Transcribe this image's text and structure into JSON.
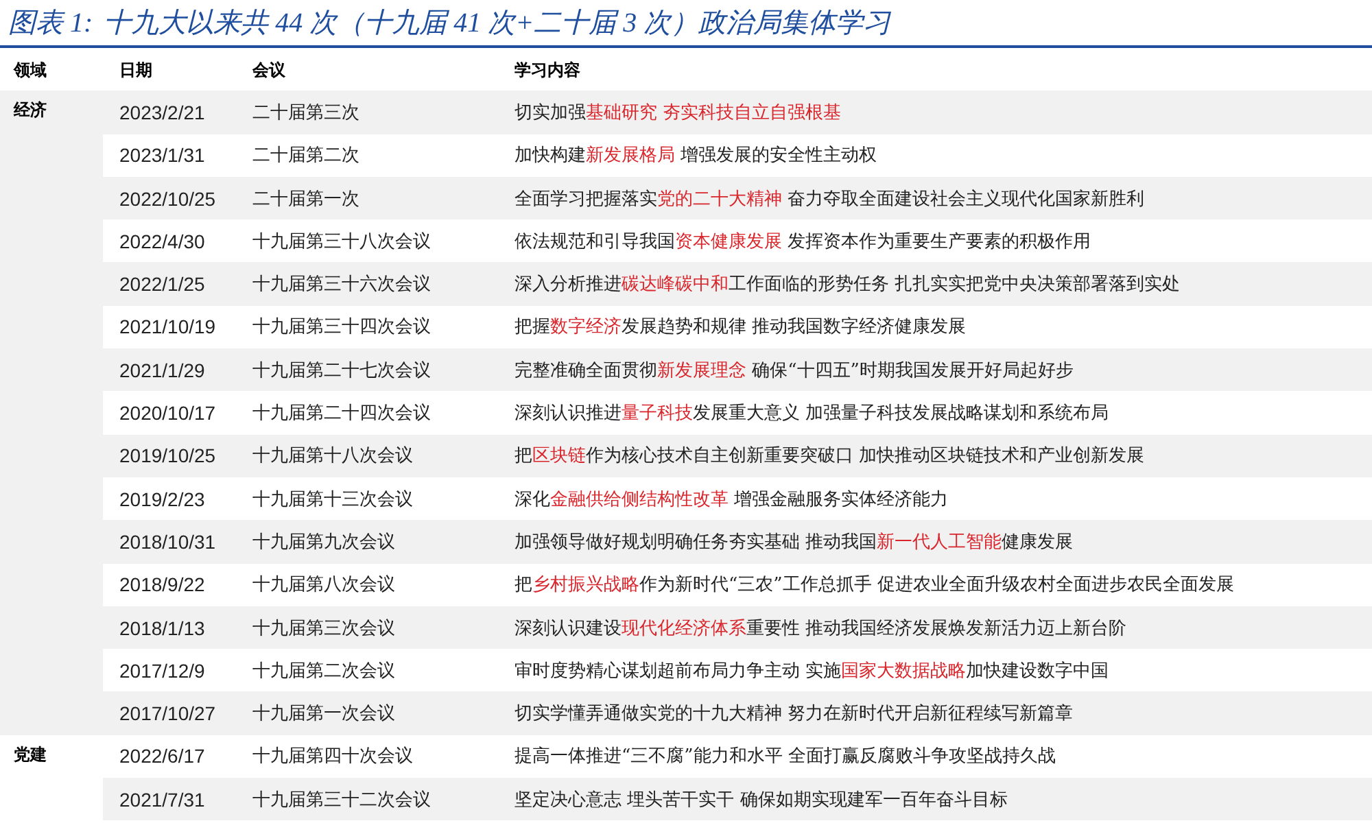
{
  "title": {
    "label": "图表 1:",
    "text": "十九大以来共 44 次（十九届 41 次+二十届 3 次）政治局集体学习"
  },
  "table": {
    "columns": [
      "领域",
      "日期",
      "会议",
      "学习内容"
    ],
    "groups": [
      {
        "domain": "经济",
        "rows": [
          {
            "date": "2023/2/21",
            "meeting": "二十届第三次",
            "content": [
              {
                "text": "切实加强",
                "highlight": false
              },
              {
                "text": "基础研究 夯实科技自立自强根基",
                "highlight": true
              }
            ]
          },
          {
            "date": "2023/1/31",
            "meeting": "二十届第二次",
            "content": [
              {
                "text": "加快构建",
                "highlight": false
              },
              {
                "text": "新发展格局",
                "highlight": true
              },
              {
                "text": " 增强发展的安全性主动权",
                "highlight": false
              }
            ]
          },
          {
            "date": "2022/10/25",
            "meeting": "二十届第一次",
            "content": [
              {
                "text": "全面学习把握落实",
                "highlight": false
              },
              {
                "text": "党的二十大精神",
                "highlight": true
              },
              {
                "text": " 奋力夺取全面建设社会主义现代化国家新胜利",
                "highlight": false
              }
            ]
          },
          {
            "date": "2022/4/30",
            "meeting": "十九届第三十八次会议",
            "content": [
              {
                "text": "依法规范和引导我国",
                "highlight": false
              },
              {
                "text": "资本健康发展",
                "highlight": true
              },
              {
                "text": " 发挥资本作为重要生产要素的积极作用",
                "highlight": false
              }
            ]
          },
          {
            "date": "2022/1/25",
            "meeting": "十九届第三十六次会议",
            "content": [
              {
                "text": "深入分析推进",
                "highlight": false
              },
              {
                "text": "碳达峰碳中和",
                "highlight": true
              },
              {
                "text": "工作面临的形势任务 扎扎实实把党中央决策部署落到实处",
                "highlight": false
              }
            ]
          },
          {
            "date": "2021/10/19",
            "meeting": "十九届第三十四次会议",
            "content": [
              {
                "text": "把握",
                "highlight": false
              },
              {
                "text": "数字经济",
                "highlight": true
              },
              {
                "text": "发展趋势和规律 推动我国数字经济健康发展",
                "highlight": false
              }
            ]
          },
          {
            "date": "2021/1/29",
            "meeting": "十九届第二十七次会议",
            "content": [
              {
                "text": "完整准确全面贯彻",
                "highlight": false
              },
              {
                "text": "新发展理念",
                "highlight": true
              },
              {
                "text": " 确保“十四五”时期我国发展开好局起好步",
                "highlight": false
              }
            ]
          },
          {
            "date": "2020/10/17",
            "meeting": "十九届第二十四次会议",
            "content": [
              {
                "text": "深刻认识推进",
                "highlight": false
              },
              {
                "text": "量子科技",
                "highlight": true
              },
              {
                "text": "发展重大意义 加强量子科技发展战略谋划和系统布局",
                "highlight": false
              }
            ]
          },
          {
            "date": "2019/10/25",
            "meeting": "十九届第十八次会议",
            "content": [
              {
                "text": "把",
                "highlight": false
              },
              {
                "text": "区块链",
                "highlight": true
              },
              {
                "text": "作为核心技术自主创新重要突破口 加快推动区块链技术和产业创新发展",
                "highlight": false
              }
            ]
          },
          {
            "date": "2019/2/23",
            "meeting": "十九届第十三次会议",
            "content": [
              {
                "text": "深化",
                "highlight": false
              },
              {
                "text": "金融供给侧结构性改革",
                "highlight": true
              },
              {
                "text": " 增强金融服务实体经济能力",
                "highlight": false
              }
            ]
          },
          {
            "date": "2018/10/31",
            "meeting": "十九届第九次会议",
            "content": [
              {
                "text": "加强领导做好规划明确任务夯实基础 推动我国",
                "highlight": false
              },
              {
                "text": "新一代人工智能",
                "highlight": true
              },
              {
                "text": "健康发展",
                "highlight": false
              }
            ]
          },
          {
            "date": "2018/9/22",
            "meeting": "十九届第八次会议",
            "content": [
              {
                "text": "把",
                "highlight": false
              },
              {
                "text": "乡村振兴战略",
                "highlight": true
              },
              {
                "text": "作为新时代“三农”工作总抓手 促进农业全面升级农村全面进步农民全面发展",
                "highlight": false
              }
            ]
          },
          {
            "date": "2018/1/13",
            "meeting": "十九届第三次会议",
            "content": [
              {
                "text": "深刻认识建设",
                "highlight": false
              },
              {
                "text": "现代化经济体系",
                "highlight": true
              },
              {
                "text": "重要性 推动我国经济发展焕发新活力迈上新台阶",
                "highlight": false
              }
            ]
          },
          {
            "date": "2017/12/9",
            "meeting": "十九届第二次会议",
            "content": [
              {
                "text": "审时度势精心谋划超前布局力争主动 实施",
                "highlight": false
              },
              {
                "text": "国家大数据战略",
                "highlight": true
              },
              {
                "text": "加快建设数字中国",
                "highlight": false
              }
            ]
          },
          {
            "date": "2017/10/27",
            "meeting": "十九届第一次会议",
            "content": [
              {
                "text": "切实学懂弄通做实党的十九大精神 努力在新时代开启新征程续写新篇章",
                "highlight": false
              }
            ]
          }
        ]
      },
      {
        "domain": "党建",
        "rows": [
          {
            "date": "2022/6/17",
            "meeting": "十九届第四十次会议",
            "content": [
              {
                "text": "提高一体推进“三不腐”能力和水平 全面打赢反腐败斗争攻坚战持久战",
                "highlight": false
              }
            ]
          },
          {
            "date": "2021/7/31",
            "meeting": "十九届第三十二次会议",
            "content": [
              {
                "text": "坚定决心意志 埋头苦干实干 确保如期实现建军一百年奋斗目标",
                "highlight": false
              }
            ]
          }
        ]
      }
    ]
  }
}
